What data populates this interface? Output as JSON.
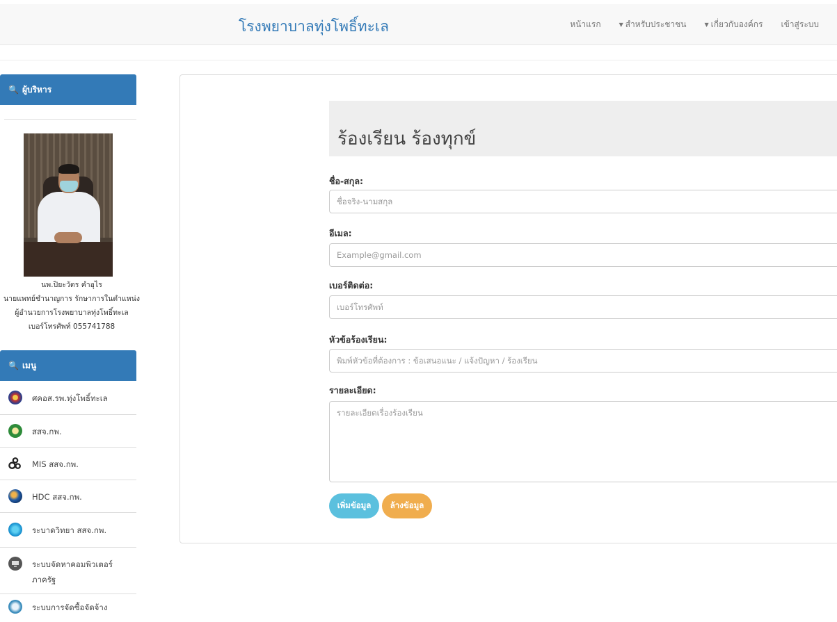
{
  "navbar": {
    "brand": "โรงพยาบาลทุ่งโพธิ์ทะเล",
    "links": [
      {
        "label": "หน้าแรก",
        "caret": false
      },
      {
        "label": "สำหรับประชาชน",
        "caret": true
      },
      {
        "label": "เกี่ยวกับองค์กร",
        "caret": true
      },
      {
        "label": "เข้าสู่ระบบ",
        "caret": false
      }
    ]
  },
  "sidebar": {
    "admin_title": "ผู้บริหาร",
    "admin": {
      "name": "นพ.ปิยะวัตร คำอุไร",
      "position": "นายแพทย์ชำนาญการ รักษาการในตำแหน่ง",
      "role": "ผู้อำนวยการโรงพยาบาลทุ่งโพธิ์ทะเล",
      "phone": "เบอร์โทรศัพท์ 055741788"
    },
    "menu_title": "เมนู",
    "menu_items": [
      {
        "label": "ศคอส.รพ.ทุ่งโพธิ์ทะเล",
        "icon": "emblem-icon",
        "color": "#c8332f"
      },
      {
        "label": "สสจ.กพ.",
        "icon": "health-logo-icon",
        "color": "#2e8b3a"
      },
      {
        "label": "MIS สสจ.กพ.",
        "icon": "gears-icon",
        "color": "#222222"
      },
      {
        "label": "HDC สสจ.กพ.",
        "icon": "database-icon",
        "color": "#1f5aa6"
      },
      {
        "label": "ระบาดวิทยา สสจ.กพ.",
        "icon": "virus-icon",
        "color": "#1e9ad6"
      },
      {
        "label": "ระบบจัดหาคอมพิวเตอร์ ภาครัฐ",
        "icon": "computer-icon",
        "color": "#555555"
      },
      {
        "label": "ระบบการจัดซื้อจัดจ้าง",
        "icon": "procurement-icon",
        "color": "#3c8dbc"
      }
    ]
  },
  "form": {
    "title": "ร้องเรียน ร้องทุกข์",
    "fields": {
      "name": {
        "label": "ชื่อ-สกุล:",
        "placeholder": "ชื่อจริง-นามสกุล"
      },
      "email": {
        "label": "อีเมล:",
        "placeholder": "Example@gmail.com"
      },
      "phone": {
        "label": "เบอร์ติดต่อ:",
        "placeholder": "เบอร์โทรศัพท์"
      },
      "subject": {
        "label": "หัวข้อร้องเรียน:",
        "placeholder": "พิมพ์หัวข้อที่ต้องการ : ข้อเสนอแนะ / แจ้งปัญหา / ร้องเรียน"
      },
      "details": {
        "label": "รายละเอียด:",
        "placeholder": "รายละเอียดเรื่องร้องเรียน"
      }
    },
    "buttons": {
      "add": "เพิ่มข้อมูล",
      "clear": "ล้างข้อมูล"
    }
  },
  "colors": {
    "primary": "#337ab7",
    "info_button": "#5bc0de",
    "warning_button": "#f0ad4e"
  }
}
